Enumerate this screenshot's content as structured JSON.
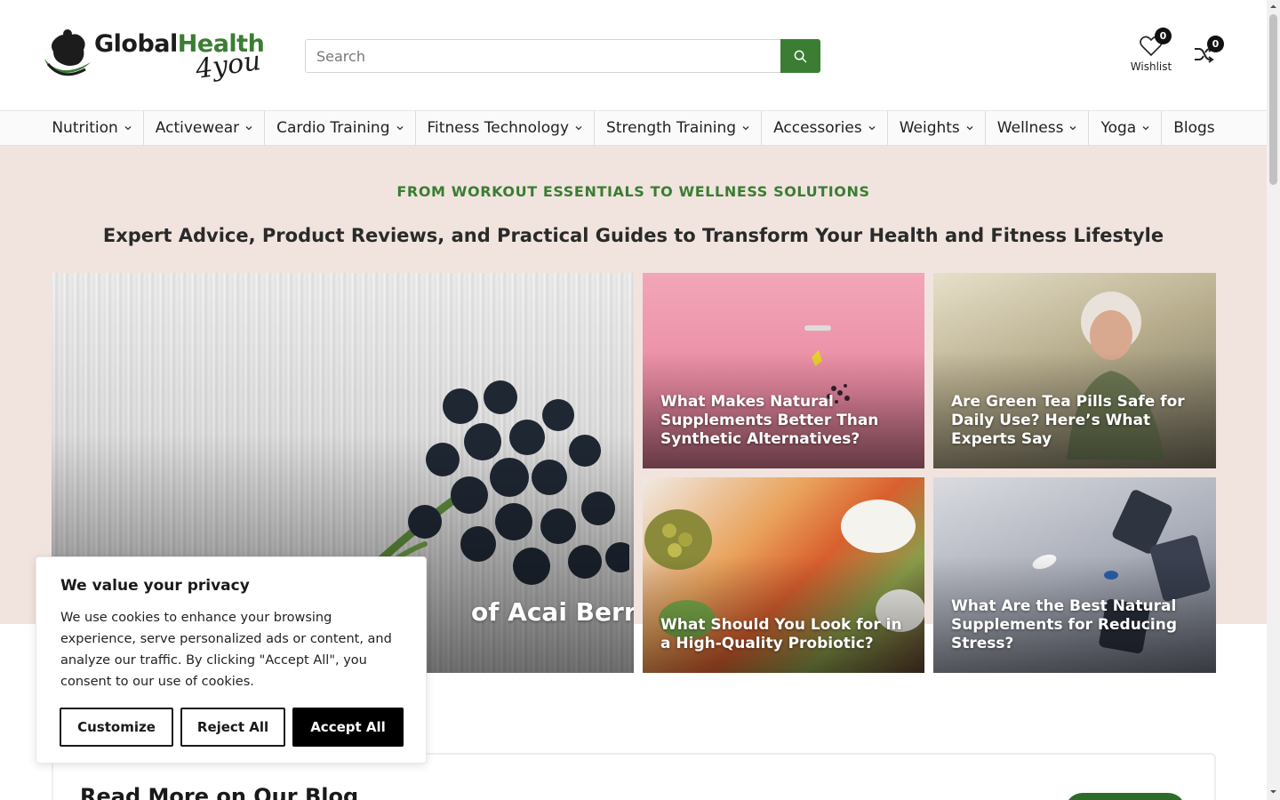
{
  "header": {
    "logo": {
      "word_primary": "Global",
      "word_accent": "Health",
      "script": "4you"
    },
    "search": {
      "placeholder": "Search",
      "value": ""
    },
    "wishlist": {
      "label": "Wishlist",
      "count": "0"
    },
    "compare": {
      "count": "0"
    }
  },
  "nav": {
    "items": [
      {
        "label": "Nutrition",
        "has_dropdown": true
      },
      {
        "label": "Activewear",
        "has_dropdown": true
      },
      {
        "label": "Cardio Training",
        "has_dropdown": true
      },
      {
        "label": "Fitness Technology",
        "has_dropdown": true
      },
      {
        "label": "Strength Training",
        "has_dropdown": true
      },
      {
        "label": "Accessories",
        "has_dropdown": true
      },
      {
        "label": "Weights",
        "has_dropdown": true
      },
      {
        "label": "Wellness",
        "has_dropdown": true
      },
      {
        "label": "Yoga",
        "has_dropdown": true
      },
      {
        "label": "Blogs",
        "has_dropdown": false
      }
    ]
  },
  "hero": {
    "tagline": "FROM WORKOUT ESSENTIALS TO WELLNESS SOLUTIONS",
    "title": "Expert Advice, Product Reviews, and Practical Guides to Transform Your Health and Fitness Lifestyle",
    "featured": {
      "title_visible": "of Acai Berries"
    },
    "cards": [
      {
        "title": "What Makes Natural Supplements Better Than Synthetic Alternatives?"
      },
      {
        "title": "Are Green Tea Pills Safe for Daily Use? Here’s What Experts Say"
      },
      {
        "title": "What Should You Look for in a High-Quality Probiotic?"
      },
      {
        "title": "What Are the Best Natural Supplements for Reducing Stress?"
      }
    ]
  },
  "blog_section": {
    "heading": "Read More on Our Blog"
  },
  "cookie_banner": {
    "title": "We value your privacy",
    "text": "We use cookies to enhance your browsing experience, serve personalized ads or content, and analyze our traffic. By clicking \"Accept All\", you consent to our use of cookies.",
    "customize_label": "Customize",
    "reject_label": "Reject All",
    "accept_label": "Accept All"
  },
  "colors": {
    "brand_green": "#3a7d33",
    "hero_background": "#f1e4de",
    "accept_button": "#000000"
  }
}
